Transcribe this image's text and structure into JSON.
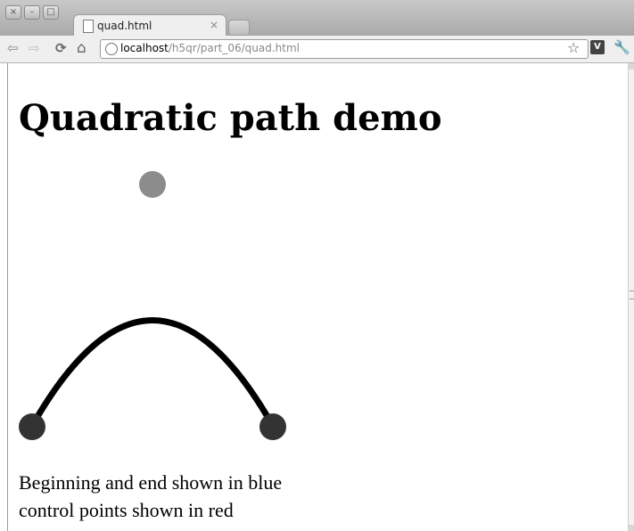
{
  "window": {
    "buttons": [
      "×",
      "–",
      "□"
    ]
  },
  "tab": {
    "title": "quad.html",
    "close": "×"
  },
  "toolbar": {
    "back": "⇦",
    "forward": "⇨",
    "reload": "⟳",
    "home": "⌂",
    "url_host": "localhost",
    "url_path": "/h5qr/part_06/quad.html",
    "bookmark": "☆",
    "extension": "V",
    "wrench": "🔧"
  },
  "page": {
    "heading": "Quadratic path demo",
    "caption_line1": "Beginning and end shown in blue",
    "caption_line2": "control points shown in red"
  },
  "colors": {
    "curve": "#000000",
    "endpoints": "#333333",
    "control_point": "#8c8c8c"
  }
}
